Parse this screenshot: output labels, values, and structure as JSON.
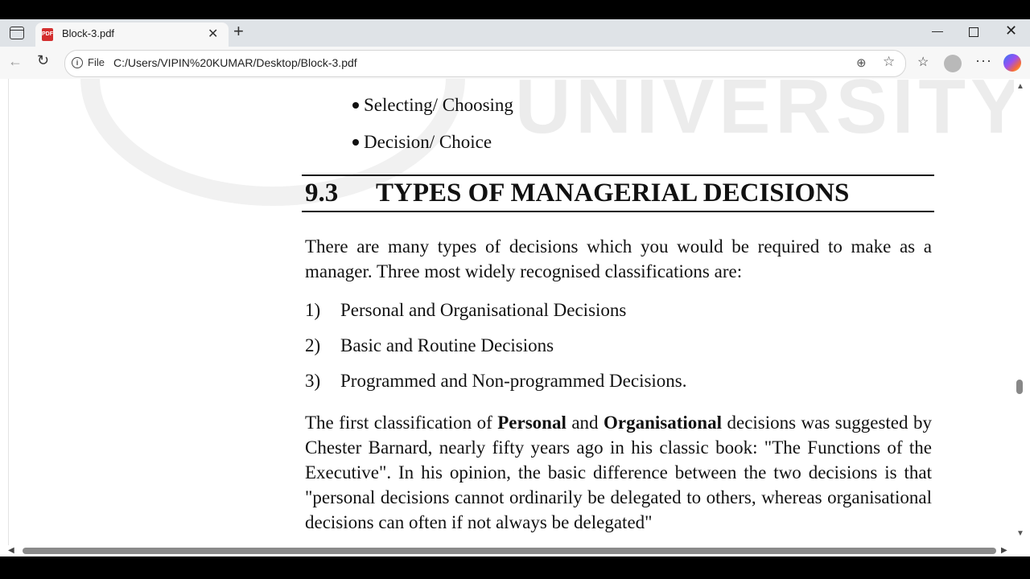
{
  "browser": {
    "tab_title": "Block-3.pdf",
    "tab_icon_label": "PDF",
    "new_tab_glyph": "+",
    "address_scheme": "File",
    "address_url": "C:/Users/VIPIN%20KUMAR/Desktop/Block-3.pdf",
    "icons": [
      "tab-actions-icon",
      "pdf-icon",
      "close-icon",
      "plus-icon",
      "back-icon",
      "reload-icon",
      "info-icon",
      "zoom-icon",
      "star-icon",
      "favorites-icon",
      "profile-icon",
      "more-icon",
      "copilot-icon",
      "minimize-icon",
      "restore-icon"
    ]
  },
  "document": {
    "watermark": "UNIVERSITY",
    "bullets": [
      "Selecting/ Choosing",
      "Decision/ Choice"
    ],
    "section_number": "9.3",
    "section_title": "TYPES OF MANAGERIAL DECISIONS",
    "intro": "There are many types of decisions which you would be required to make as a manager. Three most widely recognised classifications are:",
    "list": [
      {
        "num": "1)",
        "text": "Personal and Organisational Decisions"
      },
      {
        "num": "2)",
        "text": "Basic and Routine Decisions"
      },
      {
        "num": "3)",
        "text": "Programmed and Non-programmed Decisions."
      }
    ],
    "para2": {
      "t1": "The first classification of ",
      "b1": "Personal",
      "t2": " and ",
      "b2": "Organisational",
      "t3": " decisions was suggested by Chester Barnard, nearly fifty years ago in his classic book: \"The Functions of the Executive\". In his opinion, the basic difference between the two decisions is that \"personal decisions cannot ordinarily be delegated to others, whereas organisational decisions can often if not always be delegated\""
    }
  }
}
